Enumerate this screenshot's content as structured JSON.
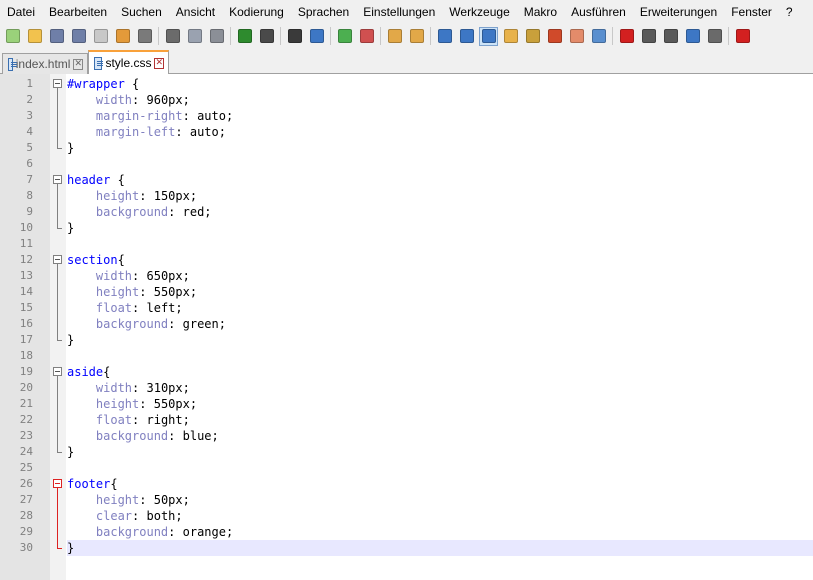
{
  "menu": [
    "Datei",
    "Bearbeiten",
    "Suchen",
    "Ansicht",
    "Kodierung",
    "Sprachen",
    "Einstellungen",
    "Werkzeuge",
    "Makro",
    "Ausführen",
    "Erweiterungen",
    "Fenster",
    "?"
  ],
  "toolbar": [
    {
      "name": "new-file-icon",
      "color": "#9ad17a"
    },
    {
      "name": "open-file-icon",
      "color": "#f2c24e"
    },
    {
      "name": "save-icon",
      "color": "#6f7fa8"
    },
    {
      "name": "save-all-icon",
      "color": "#6f7fa8"
    },
    {
      "name": "close-icon",
      "color": "#c8c8c8"
    },
    {
      "name": "close-all-icon",
      "color": "#e39a3a"
    },
    {
      "name": "print-icon",
      "color": "#7a7a7a"
    },
    {
      "sep": true
    },
    {
      "name": "cut-icon",
      "color": "#6b6b6b"
    },
    {
      "name": "copy-icon",
      "color": "#9aa2b0"
    },
    {
      "name": "paste-icon",
      "color": "#8b8f97"
    },
    {
      "sep": true
    },
    {
      "name": "undo-icon",
      "color": "#2e8b2e"
    },
    {
      "name": "redo-icon",
      "color": "#4a4a4a"
    },
    {
      "sep": true
    },
    {
      "name": "find-icon",
      "color": "#3a3a3a"
    },
    {
      "name": "replace-icon",
      "color": "#3d77c5"
    },
    {
      "sep": true
    },
    {
      "name": "zoom-in-icon",
      "color": "#4caf50"
    },
    {
      "name": "zoom-out-icon",
      "color": "#d05050"
    },
    {
      "sep": true
    },
    {
      "name": "sync-vertical-icon",
      "color": "#e2a848"
    },
    {
      "name": "sync-horizontal-icon",
      "color": "#e2a848"
    },
    {
      "sep": true
    },
    {
      "name": "word-wrap-icon",
      "color": "#3d77c5"
    },
    {
      "name": "show-all-chars-icon",
      "color": "#3d77c5"
    },
    {
      "name": "indent-guide-icon",
      "color": "#3d77c5",
      "active": true
    },
    {
      "name": "user-language-icon",
      "color": "#e8b24a"
    },
    {
      "name": "doc-map-icon",
      "color": "#c9a03b"
    },
    {
      "name": "function-list-icon",
      "color": "#d04a2a"
    },
    {
      "name": "folder-workspace-icon",
      "color": "#e38b6a"
    },
    {
      "name": "monitoring-icon",
      "color": "#5a8fcf"
    },
    {
      "sep": true
    },
    {
      "name": "macro-record-icon",
      "color": "#d32020"
    },
    {
      "name": "macro-stop-icon",
      "color": "#5a5a5a"
    },
    {
      "name": "macro-play-icon",
      "color": "#5a5a5a"
    },
    {
      "name": "macro-play-multiple-icon",
      "color": "#3d77c5"
    },
    {
      "name": "macro-save-icon",
      "color": "#6a6a6a"
    },
    {
      "sep": true
    },
    {
      "name": "spell-check-icon",
      "color": "#d32020"
    }
  ],
  "tabs": [
    {
      "label": "index.html",
      "active": false
    },
    {
      "label": "style.css",
      "active": true
    }
  ],
  "code": [
    {
      "n": "1",
      "sel": "#wrapper",
      "open": " {"
    },
    {
      "n": "2",
      "prop": "width",
      "val": " 960px;"
    },
    {
      "n": "3",
      "prop": "margin-right",
      "val": " auto;"
    },
    {
      "n": "4",
      "prop": "margin-left",
      "val": " auto;"
    },
    {
      "n": "5",
      "close": "}"
    },
    {
      "n": "6"
    },
    {
      "n": "7",
      "sel": "header",
      "open": " {"
    },
    {
      "n": "8",
      "prop": "height",
      "val": " 150px;"
    },
    {
      "n": "9",
      "prop": "background",
      "val": " red;"
    },
    {
      "n": "10",
      "close": "}"
    },
    {
      "n": "11"
    },
    {
      "n": "12",
      "sel": "section",
      "open": "{"
    },
    {
      "n": "13",
      "prop": "width",
      "val": " 650px;"
    },
    {
      "n": "14",
      "prop": "height",
      "val": " 550px;"
    },
    {
      "n": "15",
      "prop": "float",
      "val": " left;"
    },
    {
      "n": "16",
      "prop": "background",
      "val": " green;"
    },
    {
      "n": "17",
      "close": "}"
    },
    {
      "n": "18"
    },
    {
      "n": "19",
      "sel": "aside",
      "open": "{"
    },
    {
      "n": "20",
      "prop": "width",
      "val": " 310px;"
    },
    {
      "n": "21",
      "prop": "height",
      "val": " 550px;"
    },
    {
      "n": "22",
      "prop": "float",
      "val": " right;"
    },
    {
      "n": "23",
      "prop": "background",
      "val": " blue;"
    },
    {
      "n": "24",
      "close": "}"
    },
    {
      "n": "25"
    },
    {
      "n": "26",
      "sel": "footer",
      "open": "{"
    },
    {
      "n": "27",
      "prop": "height",
      "val": " 50px;"
    },
    {
      "n": "28",
      "prop": "clear",
      "val": " both;"
    },
    {
      "n": "29",
      "prop": "background",
      "val": " orange;"
    },
    {
      "n": "30",
      "close": "}"
    }
  ]
}
